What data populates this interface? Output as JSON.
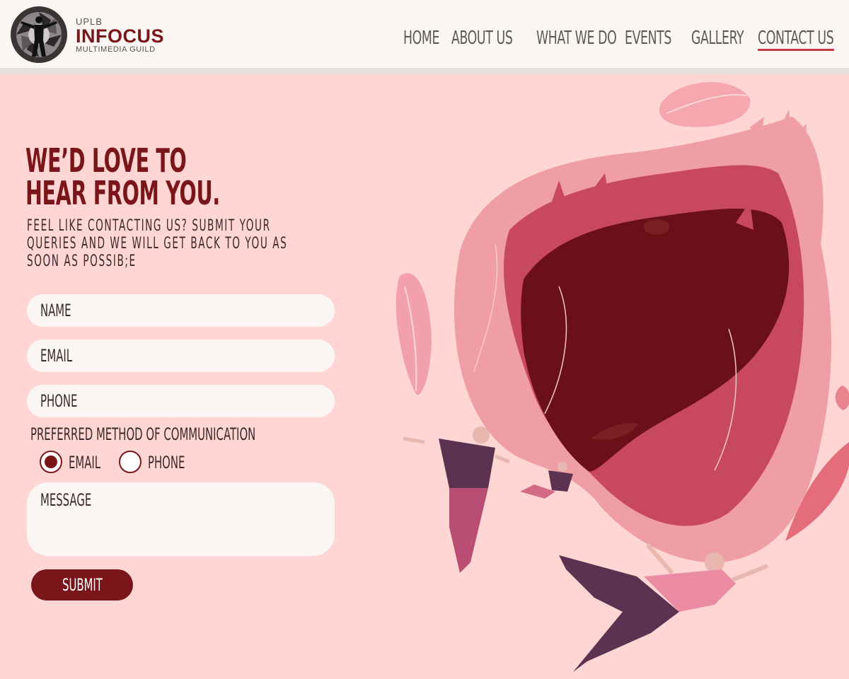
{
  "brand": {
    "top": "UPLB",
    "main": "INFOCUS",
    "sub": "MULTIMEDIA GUILD"
  },
  "nav": {
    "home": "HOME",
    "about": "ABOUT US",
    "what": "WHAT WE DO",
    "events": "EVENTS",
    "gallery": "GALLERY",
    "contact": "CONTACT US",
    "active": "CONTACT US"
  },
  "hero": {
    "headline_line1": "WE’D LOVE TO",
    "headline_line2": "HEAR FROM YOU.",
    "sub_line1": "FEEL LIKE CONTACTING US? SUBMIT YOUR",
    "sub_line2": "QUERIES AND WE WILL GET BACK TO YOU AS",
    "sub_line3": "SOON AS POSSIB;E"
  },
  "form": {
    "name_placeholder": "NAME",
    "email_placeholder": "EMAIL",
    "phone_placeholder": "PHONE",
    "pref_label": "PREFERRED METHOD OF COMMUNICATION",
    "radio_email": "EMAIL",
    "radio_phone": "PHONE",
    "selected": "EMAIL",
    "message_placeholder": "MESSAGE",
    "submit": "SUBMIT"
  },
  "colors": {
    "background": "#ffd6d3",
    "header": "#fbf6f3",
    "accent": "#7a1519",
    "nav_underline": "#c23a44",
    "field": "#fbf6f3"
  },
  "icons": {
    "logo": "photographer-aperture-logo",
    "illustration": "people-floating-from-heart-illustration"
  }
}
